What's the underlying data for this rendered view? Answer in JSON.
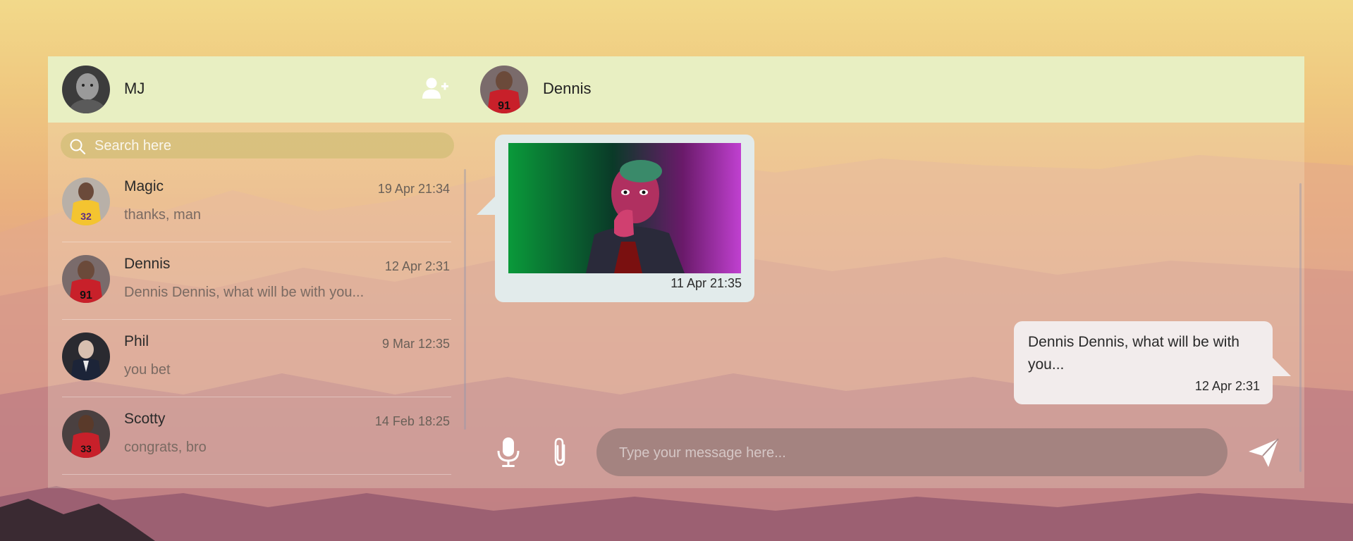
{
  "header": {
    "me_name": "MJ",
    "chat_name": "Dennis"
  },
  "search": {
    "placeholder": "Search here"
  },
  "conversations": [
    {
      "name": "Magic",
      "time": "19 Apr 21:34",
      "preview": "thanks, man"
    },
    {
      "name": "Dennis",
      "time": "12 Apr 2:31",
      "preview": "Dennis Dennis, what will be with you..."
    },
    {
      "name": "Phil",
      "time": "9 Mar 12:35",
      "preview": "you bet"
    },
    {
      "name": "Scotty",
      "time": "14 Feb 18:25",
      "preview": "congrats, bro"
    }
  ],
  "messages": {
    "incoming_time": "11 Apr 21:35",
    "outgoing_text": "Dennis Dennis, what will be with you...",
    "outgoing_time": "12 Apr 2:31"
  },
  "composer": {
    "placeholder": "Type your message here..."
  },
  "colors": {
    "topbar": "#e8efc2",
    "incoming_bubble": "#e2ebeb",
    "outgoing_bubble": "#f2ecec"
  }
}
